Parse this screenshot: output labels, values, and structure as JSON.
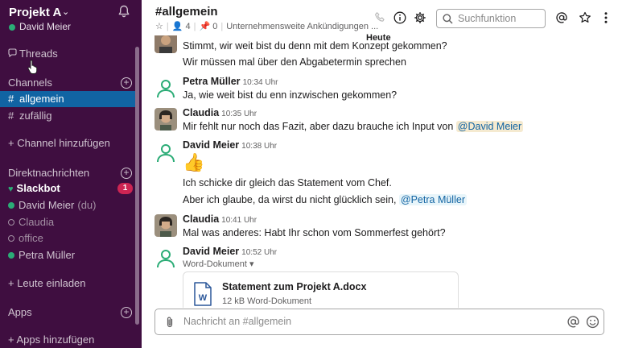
{
  "workspace": {
    "name": "Projekt A",
    "user": "David Meier"
  },
  "sidebar": {
    "threads_label": "Threads",
    "channels_heading": "Channels",
    "channels": [
      {
        "name": "allgemein",
        "active": true
      },
      {
        "name": "zufällig",
        "active": false
      }
    ],
    "add_channel": "+ Channel hinzufügen",
    "dm_heading": "Direktnachrichten",
    "dms": [
      {
        "name": "Slackbot",
        "badge": "1"
      },
      {
        "name": "David Meier",
        "suffix": "(du)"
      },
      {
        "name": "Claudia"
      },
      {
        "name": "office"
      },
      {
        "name": "Petra Müller"
      }
    ],
    "invite": "+ Leute einladen",
    "apps_heading": "Apps",
    "add_apps": "+ Apps hinzufügen"
  },
  "header": {
    "channel": "#allgemein",
    "members": "4",
    "pins": "0",
    "topic": "Unternehmensweite Ankündigungen ...",
    "search_placeholder": "Suchfunktion",
    "date_divider": "Heute"
  },
  "messages": {
    "m0_l1": "Stimmt, wir weit bist du denn mit dem Konzept gekommen?",
    "m0_l2": "Wir müssen mal über den Abgabetermin sprechen",
    "m1_author": "Petra Müller",
    "m1_time": "10:34 Uhr",
    "m1_l1": "Ja, wie weit bist du enn inzwischen gekommen?",
    "m2_author": "Claudia",
    "m2_time": "10:35 Uhr",
    "m2_l1": "Mir fehlt nur noch das Fazit, aber dazu brauche ich Input von",
    "m2_mention": "@David Meier",
    "m3_author": "David Meier",
    "m3_time": "10:38 Uhr",
    "m3_emoji": "👍",
    "m3_l1": "Ich schicke dir gleich das Statement vom Chef.",
    "m3_l2": "Aber ich glaube, da wirst du nicht glücklich sein,",
    "m3_mention": "@Petra Müller",
    "m4_author": "Claudia",
    "m4_time": "10:41 Uhr",
    "m4_l1": "Mal was anderes: Habt Ihr schon vom Sommerfest gehört?",
    "m5_author": "David Meier",
    "m5_time": "10:52 Uhr",
    "m5_filecap": "Word-Dokument",
    "file_name": "Statement zum Projekt A.docx",
    "file_meta": "12 kB Word-Dokument",
    "file_letter": "W"
  },
  "composer": {
    "placeholder": "Nachricht an #allgemein"
  },
  "colors": {
    "sidebar": "#3f0e40",
    "active": "#1164a3",
    "presence": "#2bac76",
    "badge": "#cd2553"
  }
}
